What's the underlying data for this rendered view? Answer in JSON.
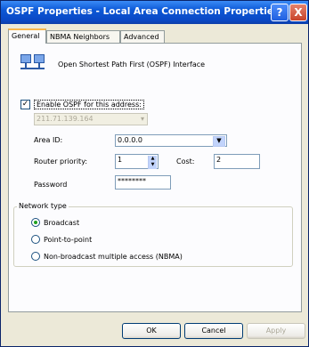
{
  "window": {
    "title": "OSPF Properties - Local Area Connection Properties"
  },
  "tabs": [
    {
      "label": "General",
      "active": true
    },
    {
      "label": "NBMA Neighbors",
      "active": false
    },
    {
      "label": "Advanced",
      "active": false
    }
  ],
  "general": {
    "description": "Open Shortest Path First (OSPF) Interface",
    "enable_checkbox": {
      "label": "Enable OSPF for this address:",
      "checked": true
    },
    "ip_address": "211.71.139.164",
    "area_id": {
      "label": "Area ID:",
      "value": "0.0.0.0"
    },
    "router_priority": {
      "label": "Router priority:",
      "value": "1"
    },
    "cost": {
      "label": "Cost:",
      "value": "2"
    },
    "password": {
      "label": "Password",
      "value": "********"
    },
    "network_type": {
      "label": "Network type",
      "options": [
        {
          "label": "Broadcast",
          "checked": true
        },
        {
          "label": "Point-to-point",
          "checked": false
        },
        {
          "label": "Non-broadcast multiple access (NBMA)",
          "checked": false
        }
      ]
    }
  },
  "buttons": {
    "ok": "OK",
    "cancel": "Cancel",
    "apply": "Apply"
  },
  "titlebar_buttons": {
    "help": "?",
    "close": "X"
  }
}
